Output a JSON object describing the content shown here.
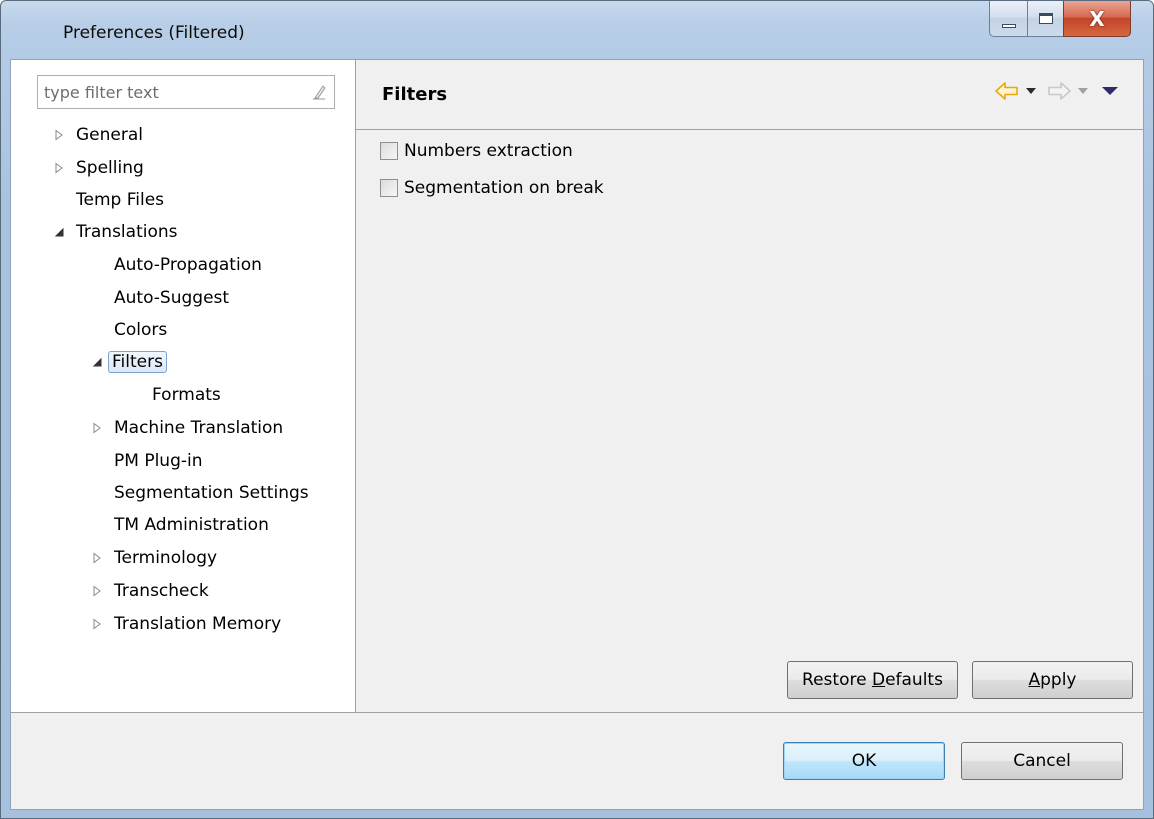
{
  "window": {
    "title": "Preferences (Filtered)",
    "caption_buttons": [
      {
        "name": "minimize",
        "icon": "minimize-icon"
      },
      {
        "name": "maximize",
        "icon": "maximize-icon"
      },
      {
        "name": "close",
        "icon": "close-icon",
        "glyph": "X"
      }
    ]
  },
  "filter": {
    "placeholder": "type filter text",
    "value": "",
    "clear_icon": "eraser-icon"
  },
  "tree": {
    "items": [
      {
        "label": "General",
        "expander": "collapsed"
      },
      {
        "label": "Spelling",
        "expander": "collapsed"
      },
      {
        "label": "Temp Files",
        "expander": "none"
      },
      {
        "label": "Translations",
        "expander": "expanded"
      },
      {
        "label": "Auto-Propagation",
        "expander": "none"
      },
      {
        "label": "Auto-Suggest",
        "expander": "none"
      },
      {
        "label": "Colors",
        "expander": "none"
      },
      {
        "label": "Filters",
        "expander": "expanded",
        "selected": true
      },
      {
        "label": "Formats",
        "expander": "none"
      },
      {
        "label": "Machine Translation",
        "expander": "collapsed"
      },
      {
        "label": "PM Plug-in",
        "expander": "none"
      },
      {
        "label": "Segmentation Settings",
        "expander": "none"
      },
      {
        "label": "TM Administration",
        "expander": "none"
      },
      {
        "label": "Terminology",
        "expander": "collapsed"
      },
      {
        "label": "Transcheck",
        "expander": "collapsed"
      },
      {
        "label": "Translation Memory",
        "expander": "collapsed"
      }
    ]
  },
  "page": {
    "title": "Filters",
    "nav": {
      "back_icon": "back-arrow-icon",
      "forward_icon": "forward-arrow-icon",
      "menu_icon": "view-menu-icon",
      "back_color": "#e6a817",
      "forward_color": "#c8c8c8"
    },
    "options": [
      {
        "label": "Numbers extraction",
        "checked": false
      },
      {
        "label": "Segmentation on break",
        "checked": false
      }
    ],
    "restore_defaults": {
      "pre": "Restore ",
      "mnemonic": "D",
      "post": "efaults"
    },
    "apply": {
      "pre": "",
      "mnemonic": "A",
      "post": "pply"
    }
  },
  "dialog_buttons": {
    "ok": "OK",
    "cancel": "Cancel"
  }
}
